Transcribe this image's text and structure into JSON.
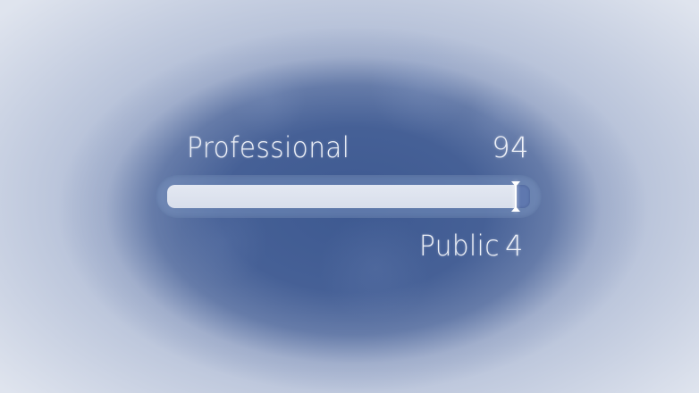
{
  "professional": {
    "label": "Professional",
    "value": "94"
  },
  "public": {
    "label": "Public",
    "value": "4"
  },
  "balance_bar": {
    "professional_fraction": 0.96,
    "fill_color": "#d8deeb",
    "remainder_color": "#5f78af",
    "marker_icon": "split-marker-icon"
  },
  "colors": {
    "background_center": "#3c5890",
    "background_edge": "#dfe4ee",
    "text": "#eef1f8"
  }
}
